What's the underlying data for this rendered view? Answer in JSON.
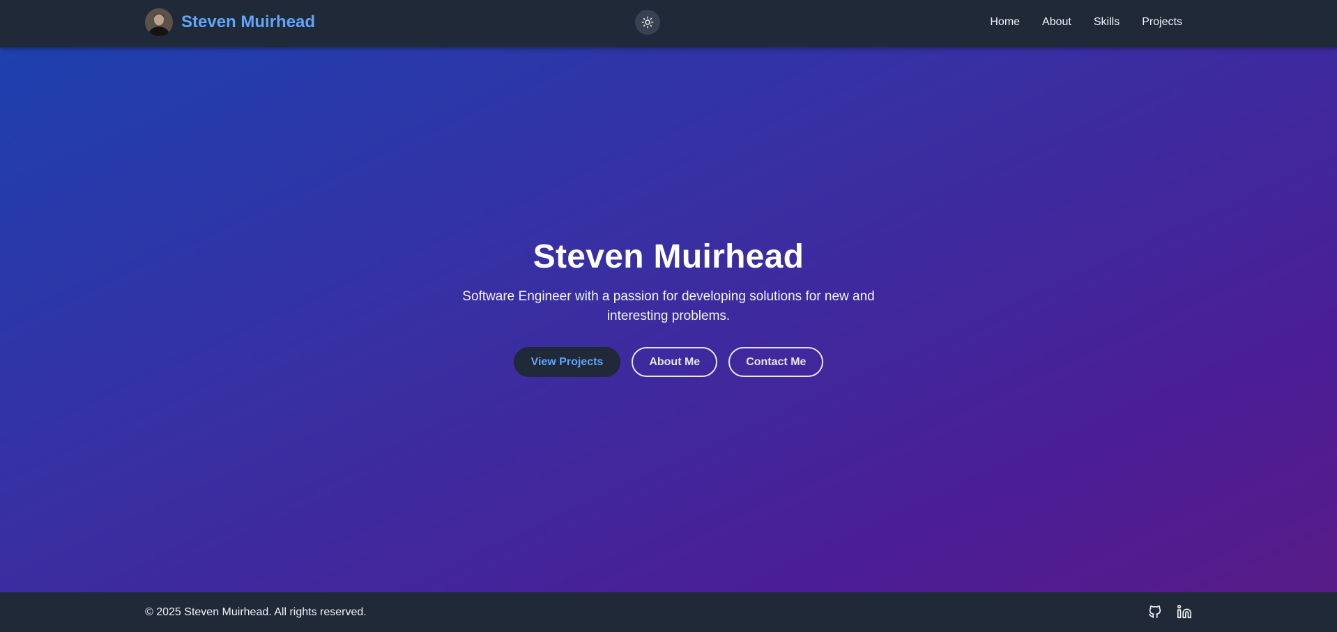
{
  "header": {
    "brand_name": "Steven Muirhead",
    "avatar_icon": "profile-photo",
    "theme_toggle_icon": "sun-icon",
    "nav": [
      {
        "label": "Home"
      },
      {
        "label": "About"
      },
      {
        "label": "Skills"
      },
      {
        "label": "Projects"
      }
    ]
  },
  "hero": {
    "title": "Steven Muirhead",
    "subtitle": "Software Engineer with a passion for developing solutions for new and interesting problems.",
    "buttons": {
      "view_projects": "View Projects",
      "about_me": "About Me",
      "contact_me": "Contact Me"
    }
  },
  "footer": {
    "copyright": "© 2025 Steven Muirhead. All rights reserved.",
    "social": [
      {
        "icon": "github-icon"
      },
      {
        "icon": "linkedin-icon"
      }
    ]
  },
  "colors": {
    "header_bg": "#1f2937",
    "brand_accent": "#60a5fa",
    "hero_gradient_start": "#1e40af",
    "hero_gradient_end": "#581c87"
  }
}
